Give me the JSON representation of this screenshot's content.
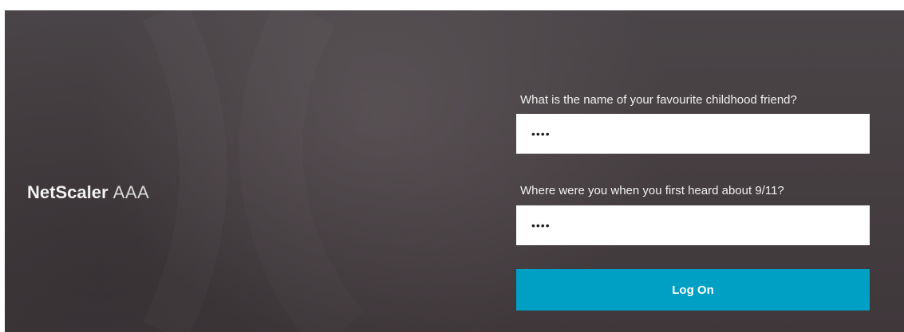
{
  "brand": {
    "name_bold": "NetScaler",
    "name_light": "AAA"
  },
  "form": {
    "question1": {
      "label": "What is the name of your favourite childhood friend?",
      "value": "••••"
    },
    "question2": {
      "label": "Where were you when you first heard about 9/11?",
      "value": "••••"
    },
    "submit_label": "Log On"
  },
  "colors": {
    "background": "#463f42",
    "button": "#009fc4",
    "input_background": "#ffffff",
    "text": "#f0f0f0"
  }
}
